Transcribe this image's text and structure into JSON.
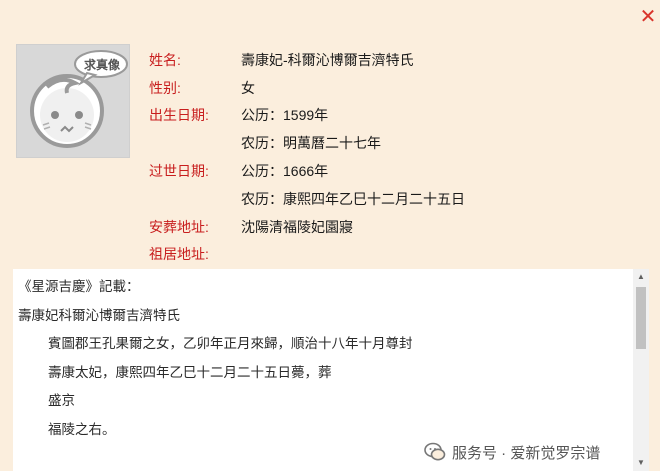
{
  "avatar_badge": "求真像",
  "fields": [
    {
      "label": "姓名:",
      "value": "壽康妃-科爾沁博爾吉濟特氏"
    },
    {
      "label": "性别:",
      "value": "女"
    },
    {
      "label": "出生日期:",
      "value": "公历：1599年"
    },
    {
      "label": "",
      "value": "农历：明萬曆二十七年"
    },
    {
      "label": "过世日期:",
      "value": "公历：1666年"
    },
    {
      "label": "",
      "value": "农历：康熙四年乙巳十二月二十五日"
    },
    {
      "label": "安葬地址:",
      "value": "沈陽清福陵妃園寢"
    },
    {
      "label": "祖居地址:",
      "value": ""
    }
  ],
  "record": {
    "source": "《星源吉慶》記載：",
    "name": "壽康妃科爾沁博爾吉濟特氏",
    "lines": [
      "賓圖郡王孔果爾之女，乙卯年正月來歸，順治十八年十月尊封",
      "壽康太妃，康熙四年乙巳十二月二十五日薨，葬",
      "盛京",
      "福陵之右。"
    ]
  },
  "watermark": "服务号 · 爱新觉罗宗谱",
  "colors": {
    "background": "#fbeedd",
    "label": "#c81e1e",
    "close": "#d9342b"
  }
}
